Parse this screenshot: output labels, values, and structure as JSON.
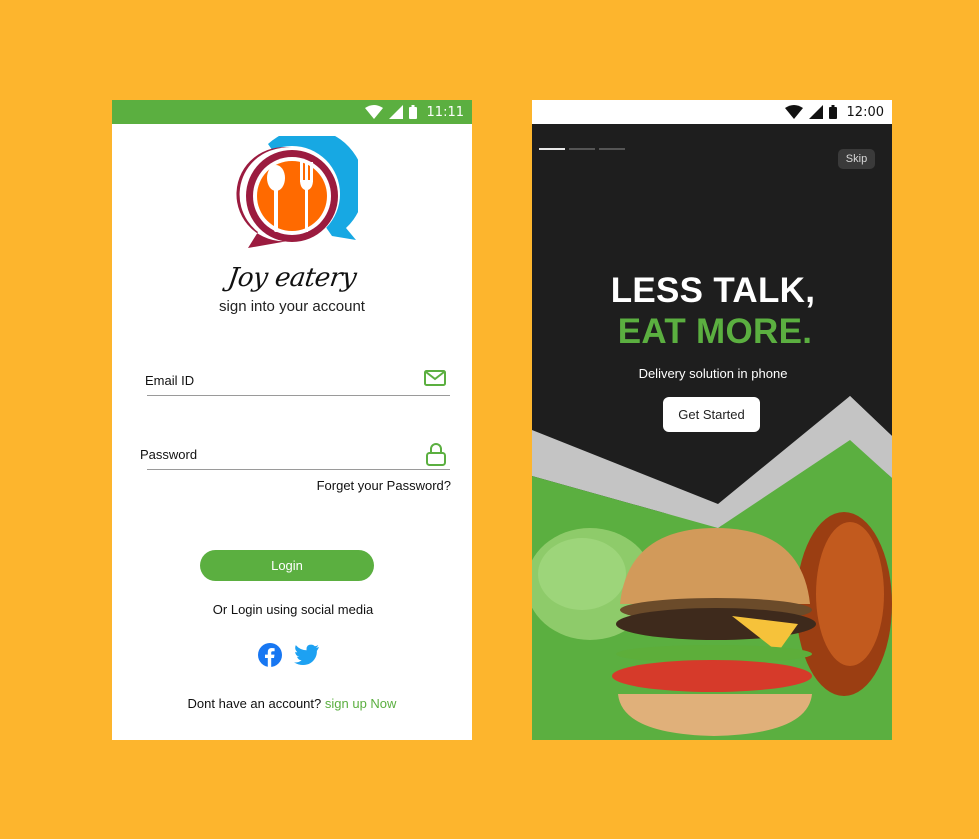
{
  "colors": {
    "background": "#FDB52D",
    "brand_green": "#5BAF40",
    "dark_panel": "#1E1E1E",
    "accent_blue": "#1DA1F2"
  },
  "login_screen": {
    "status_time": "11:11",
    "brand_name": "Joy eatery",
    "subtitle": "sign into your account",
    "email_label": "Email ID",
    "password_label": "Password",
    "forgot_link": "Forget your Password?",
    "login_button": "Login",
    "social_text": "Or Login using social media",
    "signup_prompt": "Dont have an account?",
    "signup_link": "sign up Now",
    "icons": [
      "mail-icon",
      "lock-icon",
      "facebook-icon",
      "twitter-icon"
    ]
  },
  "onboarding_screen": {
    "status_time": "12:00",
    "skip_button": "Skip",
    "headline_line1": "LESS TALK,",
    "headline_line2": "EAT MORE.",
    "tagline": "Delivery solution in phone",
    "get_started_button": "Get Started",
    "progress_steps": 3,
    "active_step": 1
  }
}
